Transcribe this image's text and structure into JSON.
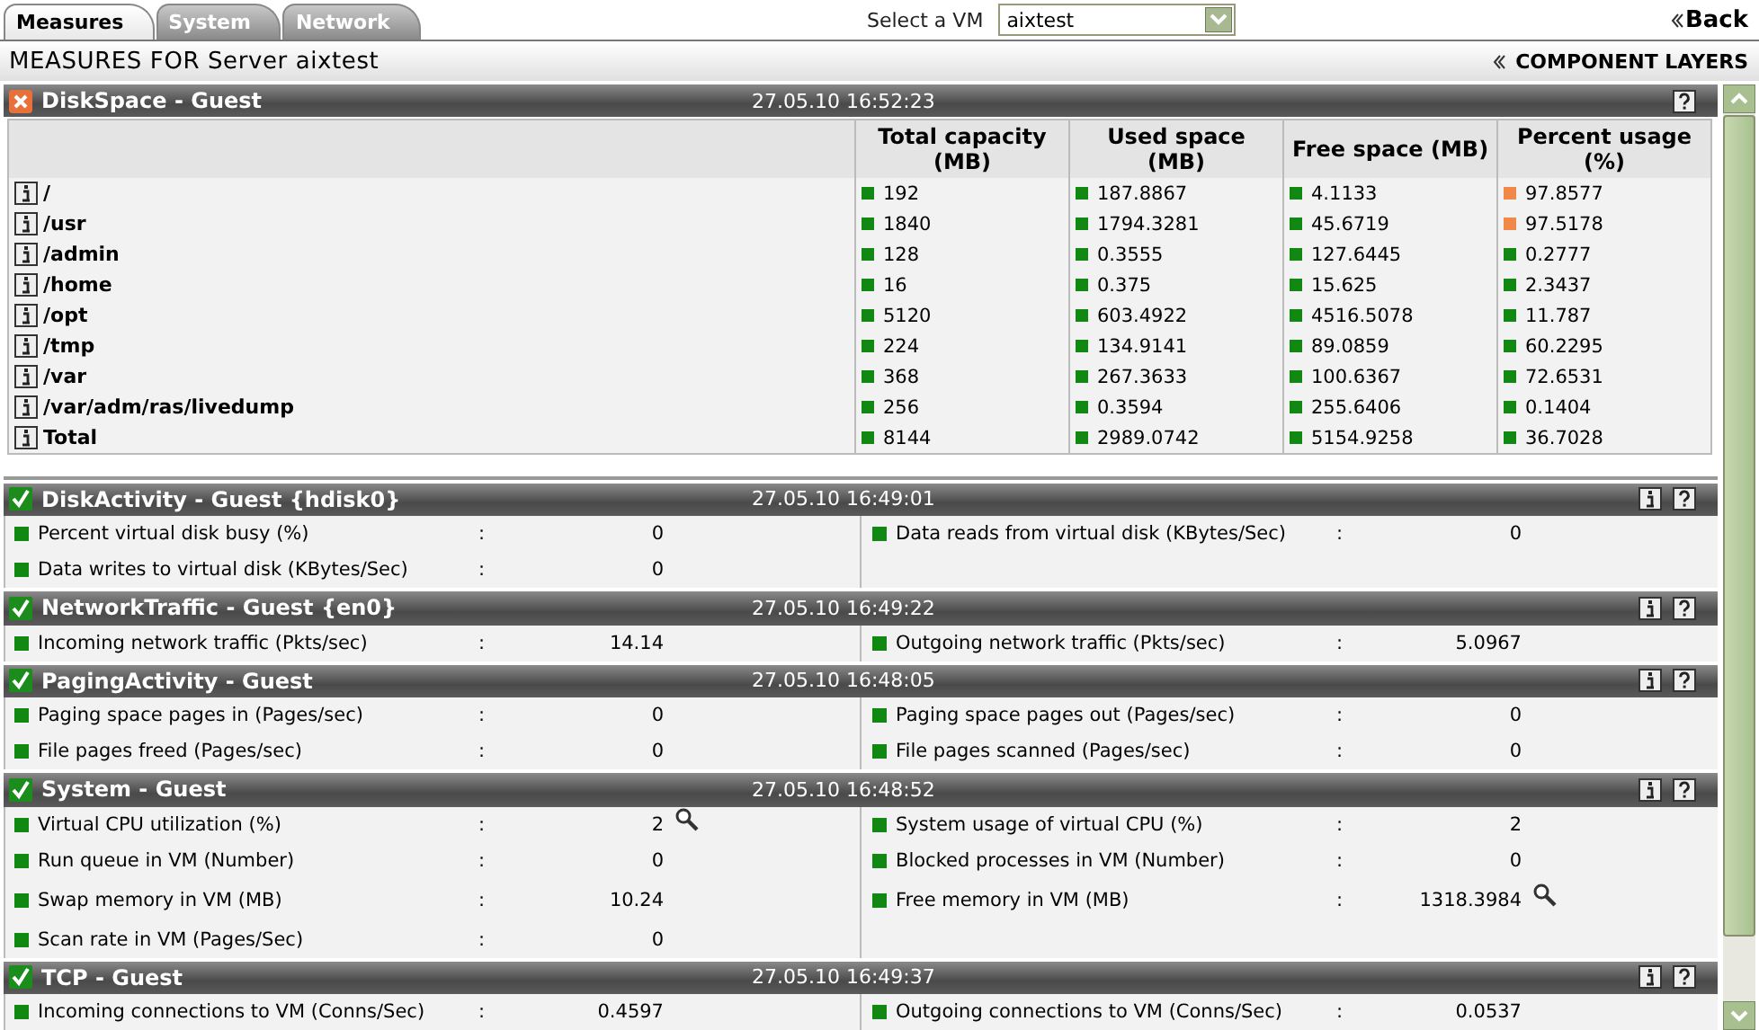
{
  "tabs": [
    {
      "label": "Measures",
      "selected": true
    },
    {
      "label": "System",
      "selected": false
    },
    {
      "label": "Network",
      "selected": false
    }
  ],
  "vm_select": {
    "label": "Select a VM",
    "value": "aixtest"
  },
  "back_link": "Back",
  "page_title": "MEASURES FOR Server aixtest",
  "layers_link": "COMPONENT LAYERS",
  "disk_space": {
    "title": "DiskSpace - Guest",
    "failed": true,
    "timestamp": "27.05.10 16:52:23",
    "columns": [
      "Total capacity (MB)",
      "Used space (MB)",
      "Free space (MB)",
      "Percent usage (%)"
    ],
    "rows": [
      {
        "name": "/",
        "cells": [
          {
            "text": "192",
            "color": "#118811"
          },
          {
            "text": "187.8867",
            "color": "#118811"
          },
          {
            "text": "4.1133",
            "color": "#118811"
          },
          {
            "text": "97.8577",
            "color": "#f08848"
          }
        ]
      },
      {
        "name": "/usr",
        "cells": [
          {
            "text": "1840",
            "color": "#118811"
          },
          {
            "text": "1794.3281",
            "color": "#118811"
          },
          {
            "text": "45.6719",
            "color": "#118811"
          },
          {
            "text": "97.5178",
            "color": "#f08848"
          }
        ]
      },
      {
        "name": "/admin",
        "cells": [
          {
            "text": "128",
            "color": "#118811"
          },
          {
            "text": "0.3555",
            "color": "#118811"
          },
          {
            "text": "127.6445",
            "color": "#118811"
          },
          {
            "text": "0.2777",
            "color": "#118811"
          }
        ]
      },
      {
        "name": "/home",
        "cells": [
          {
            "text": "16",
            "color": "#118811"
          },
          {
            "text": "0.375",
            "color": "#118811"
          },
          {
            "text": "15.625",
            "color": "#118811"
          },
          {
            "text": "2.3437",
            "color": "#118811"
          }
        ]
      },
      {
        "name": "/opt",
        "cells": [
          {
            "text": "5120",
            "color": "#118811"
          },
          {
            "text": "603.4922",
            "color": "#118811"
          },
          {
            "text": "4516.5078",
            "color": "#118811"
          },
          {
            "text": "11.787",
            "color": "#118811"
          }
        ]
      },
      {
        "name": "/tmp",
        "cells": [
          {
            "text": "224",
            "color": "#118811"
          },
          {
            "text": "134.9141",
            "color": "#118811"
          },
          {
            "text": "89.0859",
            "color": "#118811"
          },
          {
            "text": "60.2295",
            "color": "#118811"
          }
        ]
      },
      {
        "name": "/var",
        "cells": [
          {
            "text": "368",
            "color": "#118811"
          },
          {
            "text": "267.3633",
            "color": "#118811"
          },
          {
            "text": "100.6367",
            "color": "#118811"
          },
          {
            "text": "72.6531",
            "color": "#118811"
          }
        ]
      },
      {
        "name": "/var/adm/ras/livedump",
        "cells": [
          {
            "text": "256",
            "color": "#118811"
          },
          {
            "text": "0.3594",
            "color": "#118811"
          },
          {
            "text": "255.6406",
            "color": "#118811"
          },
          {
            "text": "0.1404",
            "color": "#118811"
          }
        ]
      },
      {
        "name": "Total",
        "cells": [
          {
            "text": "8144",
            "color": "#118811"
          },
          {
            "text": "2989.0742",
            "color": "#118811"
          },
          {
            "text": "5154.9258",
            "color": "#118811"
          },
          {
            "text": "36.7028",
            "color": "#118811"
          }
        ]
      }
    ]
  },
  "sections": [
    {
      "title": "DiskActivity - Guest {hdisk0}",
      "failed": false,
      "timestamp": "27.05.10 16:49:01",
      "left": [
        {
          "label": "Percent virtual disk busy (%)",
          "colon": ":",
          "value": "0",
          "zoom": false
        },
        {
          "label": "Data writes to virtual disk (KBytes/Sec)",
          "colon": ":",
          "value": "0",
          "zoom": false
        }
      ],
      "right": [
        {
          "label": "Data reads from virtual disk (KBytes/Sec)",
          "colon": ":",
          "value": "0",
          "zoom": false
        }
      ]
    },
    {
      "title": "NetworkTraffic - Guest {en0}",
      "failed": false,
      "timestamp": "27.05.10 16:49:22",
      "left": [
        {
          "label": "Incoming network traffic (Pkts/sec)",
          "colon": ":",
          "value": "14.14",
          "zoom": false
        }
      ],
      "right": [
        {
          "label": "Outgoing network traffic (Pkts/sec)",
          "colon": ":",
          "value": "5.0967",
          "zoom": false
        }
      ]
    },
    {
      "title": "PagingActivity - Guest",
      "failed": false,
      "timestamp": "27.05.10 16:48:05",
      "left": [
        {
          "label": "Paging space pages in (Pages/sec)",
          "colon": ":",
          "value": "0",
          "zoom": false
        },
        {
          "label": "File pages freed (Pages/sec)",
          "colon": ":",
          "value": "0",
          "zoom": false
        }
      ],
      "right": [
        {
          "label": "Paging space pages out (Pages/sec)",
          "colon": ":",
          "value": "0",
          "zoom": false
        },
        {
          "label": "File pages scanned (Pages/sec)",
          "colon": ":",
          "value": "0",
          "zoom": false
        }
      ]
    },
    {
      "title": "System - Guest",
      "failed": false,
      "timestamp": "27.05.10 16:48:52",
      "left": [
        {
          "label": "Virtual CPU utilization (%)",
          "colon": ":",
          "value": "2",
          "zoom": true
        },
        {
          "label": "Run queue in VM (Number)",
          "colon": ":",
          "value": "0",
          "zoom": false
        },
        {
          "label": "Swap memory in VM (MB)",
          "colon": ":",
          "value": "10.24",
          "zoom": false
        },
        {
          "label": "Scan rate in VM (Pages/Sec)",
          "colon": ":",
          "value": "0",
          "zoom": false
        }
      ],
      "right": [
        {
          "label": "System usage of virtual CPU (%)",
          "colon": ":",
          "value": "2",
          "zoom": false
        },
        {
          "label": "Blocked processes in VM (Number)",
          "colon": ":",
          "value": "0",
          "zoom": false
        },
        {
          "label": "Free memory in VM (MB)",
          "colon": ":",
          "value": "1318.3984",
          "zoom": true
        }
      ]
    },
    {
      "title": "TCP - Guest",
      "failed": false,
      "timestamp": "27.05.10 16:49:37",
      "left": [
        {
          "label": "Incoming connections to VM (Conns/Sec)",
          "colon": ":",
          "value": "0.4597",
          "zoom": false
        }
      ],
      "right": [
        {
          "label": "Outgoing connections to VM (Conns/Sec)",
          "colon": ":",
          "value": "0.0537",
          "zoom": false
        }
      ]
    }
  ]
}
